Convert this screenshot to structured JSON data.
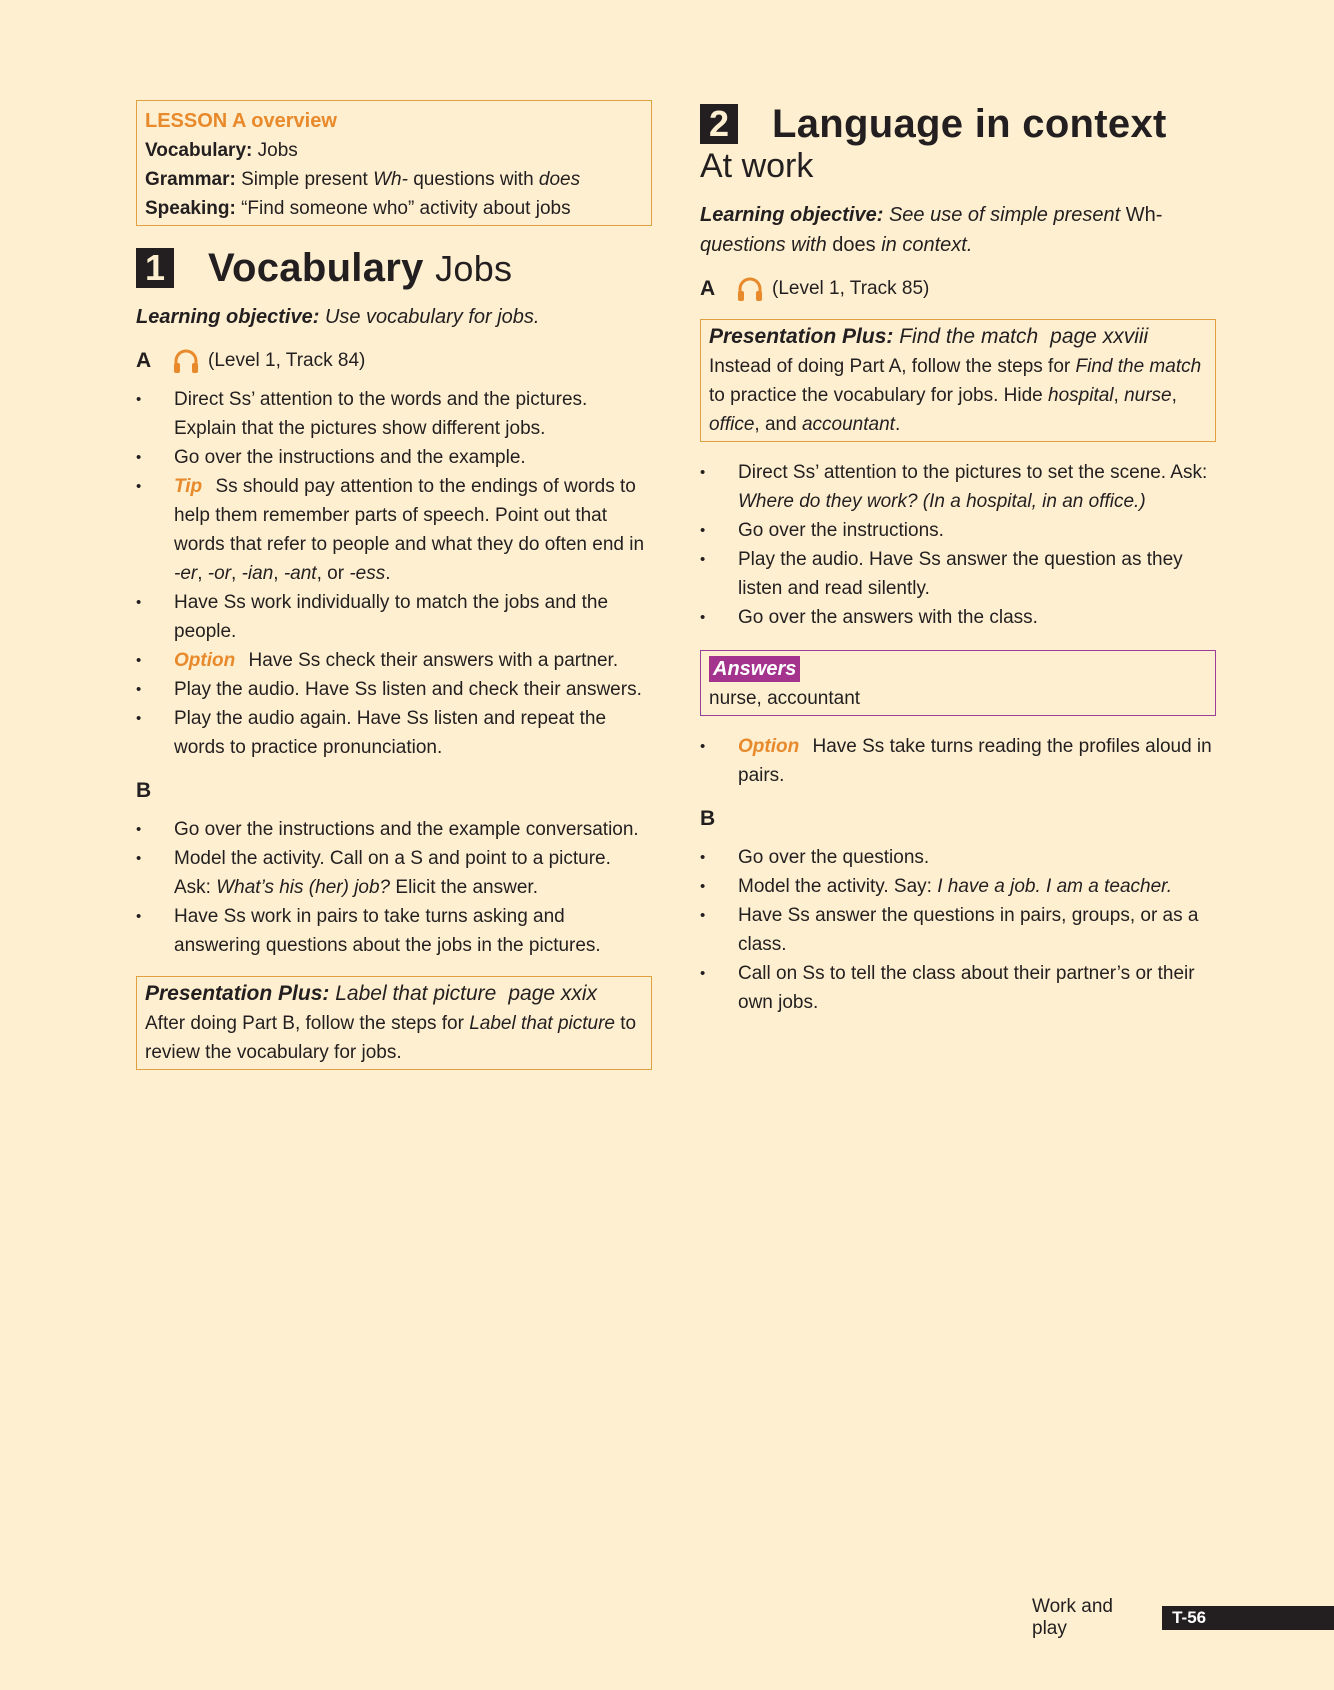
{
  "overview": {
    "title": "LESSON A overview",
    "vocab_label": "Vocabulary:",
    "vocab_value": "Jobs",
    "grammar_label": "Grammar:",
    "grammar_pre": "Simple present ",
    "grammar_wh": "Wh-",
    "grammar_mid": " questions with ",
    "grammar_does": "does",
    "speaking_label": "Speaking:",
    "speaking_value": "“Find someone who” activity about jobs"
  },
  "section1": {
    "number": "1",
    "title": "Vocabulary",
    "subtitle": "Jobs",
    "objective_label": "Learning objective:",
    "objective_text": "Use vocabulary for jobs.",
    "part_a": {
      "letter": "A",
      "track": "(Level 1, Track 84)",
      "b1": "Direct Ss’ attention to the words and the pictures. Explain that the pictures show different jobs.",
      "b2": "Go over the instructions and the example.",
      "b3_label": "Tip",
      "b3_text": "Ss should pay attention to the endings of words to help them remember parts of speech. Point out that words that refer to people and what they do often end in ",
      "b3_e1": "-er",
      "b3_e2": "-or",
      "b3_e3": "-ian",
      "b3_e4": "-ant",
      "b3_e5": "-ess",
      "b4": "Have Ss work individually to match the jobs and the people.",
      "b5_label": "Option",
      "b5_text": "Have Ss check their answers with a partner.",
      "b6": "Play the audio. Have Ss listen and check their answers.",
      "b7": "Play the audio again. Have Ss listen and repeat the words to practice pronunciation."
    },
    "part_b": {
      "letter": "B",
      "b1": "Go over the instructions and the example conversation.",
      "b2_pre": "Model the activity. Call on a S and point to a picture. Ask: ",
      "b2_q": "What’s his (her) job?",
      "b2_post": " Elicit the answer.",
      "b3": "Have Ss work in pairs to take turns asking and answering questions about the jobs in the pictures."
    },
    "pres": {
      "label": "Presentation Plus:",
      "name": "Label that picture",
      "page": "page xxix",
      "text_pre": "After doing Part B, follow the steps for ",
      "text_it": "Label that picture",
      "text_post": " to review the vocabulary for jobs."
    }
  },
  "section2": {
    "number": "2",
    "title": "Language in context",
    "subtitle": "At work",
    "objective_label": "Learning objective:",
    "objective_1": "See use of simple present ",
    "objective_wh": "Wh-",
    "objective_2": " questions with ",
    "objective_does": "does",
    "objective_3": " in context.",
    "part_a": {
      "letter": "A",
      "track": "(Level 1, Track 85)",
      "pres": {
        "label": "Presentation Plus:",
        "name": "Find the match",
        "page": "page xxviii",
        "t1": "Instead of doing Part A, follow the steps for ",
        "t2": "Find the match",
        "t3": " to practice the vocabulary for jobs. Hide ",
        "w1": "hospital",
        "w2": "nurse",
        "w3": "office",
        "w4": "accountant"
      },
      "b1_pre": "Direct Ss’ attention to the pictures to set the scene. Ask: ",
      "b1_q": "Where do they work? (In a hospital, in an office.)",
      "b2": "Go over the instructions.",
      "b3": "Play the audio. Have Ss answer the question as they listen and read silently.",
      "b4": "Go over the answers with the class.",
      "answers_label": "Answers",
      "answers_text": "nurse, accountant",
      "b5_label": "Option",
      "b5_text": "Have Ss take turns reading the profiles aloud in pairs."
    },
    "part_b": {
      "letter": "B",
      "b1": "Go over the questions.",
      "b2_pre": "Model the activity. Say: ",
      "b2_q": "I have a job. I am a teacher.",
      "b3": "Have Ss answer the questions in pairs, groups, or as a class.",
      "b4": "Call on Ss to tell the class about their partner’s or their own jobs."
    }
  },
  "footer": {
    "unit": "Work and play",
    "page": "T-56"
  },
  "colors": {
    "background": "#fdefcf",
    "orange": "#e8892b",
    "box_border": "#e0a040",
    "answers": "#a3338d",
    "dark": "#231f20"
  }
}
